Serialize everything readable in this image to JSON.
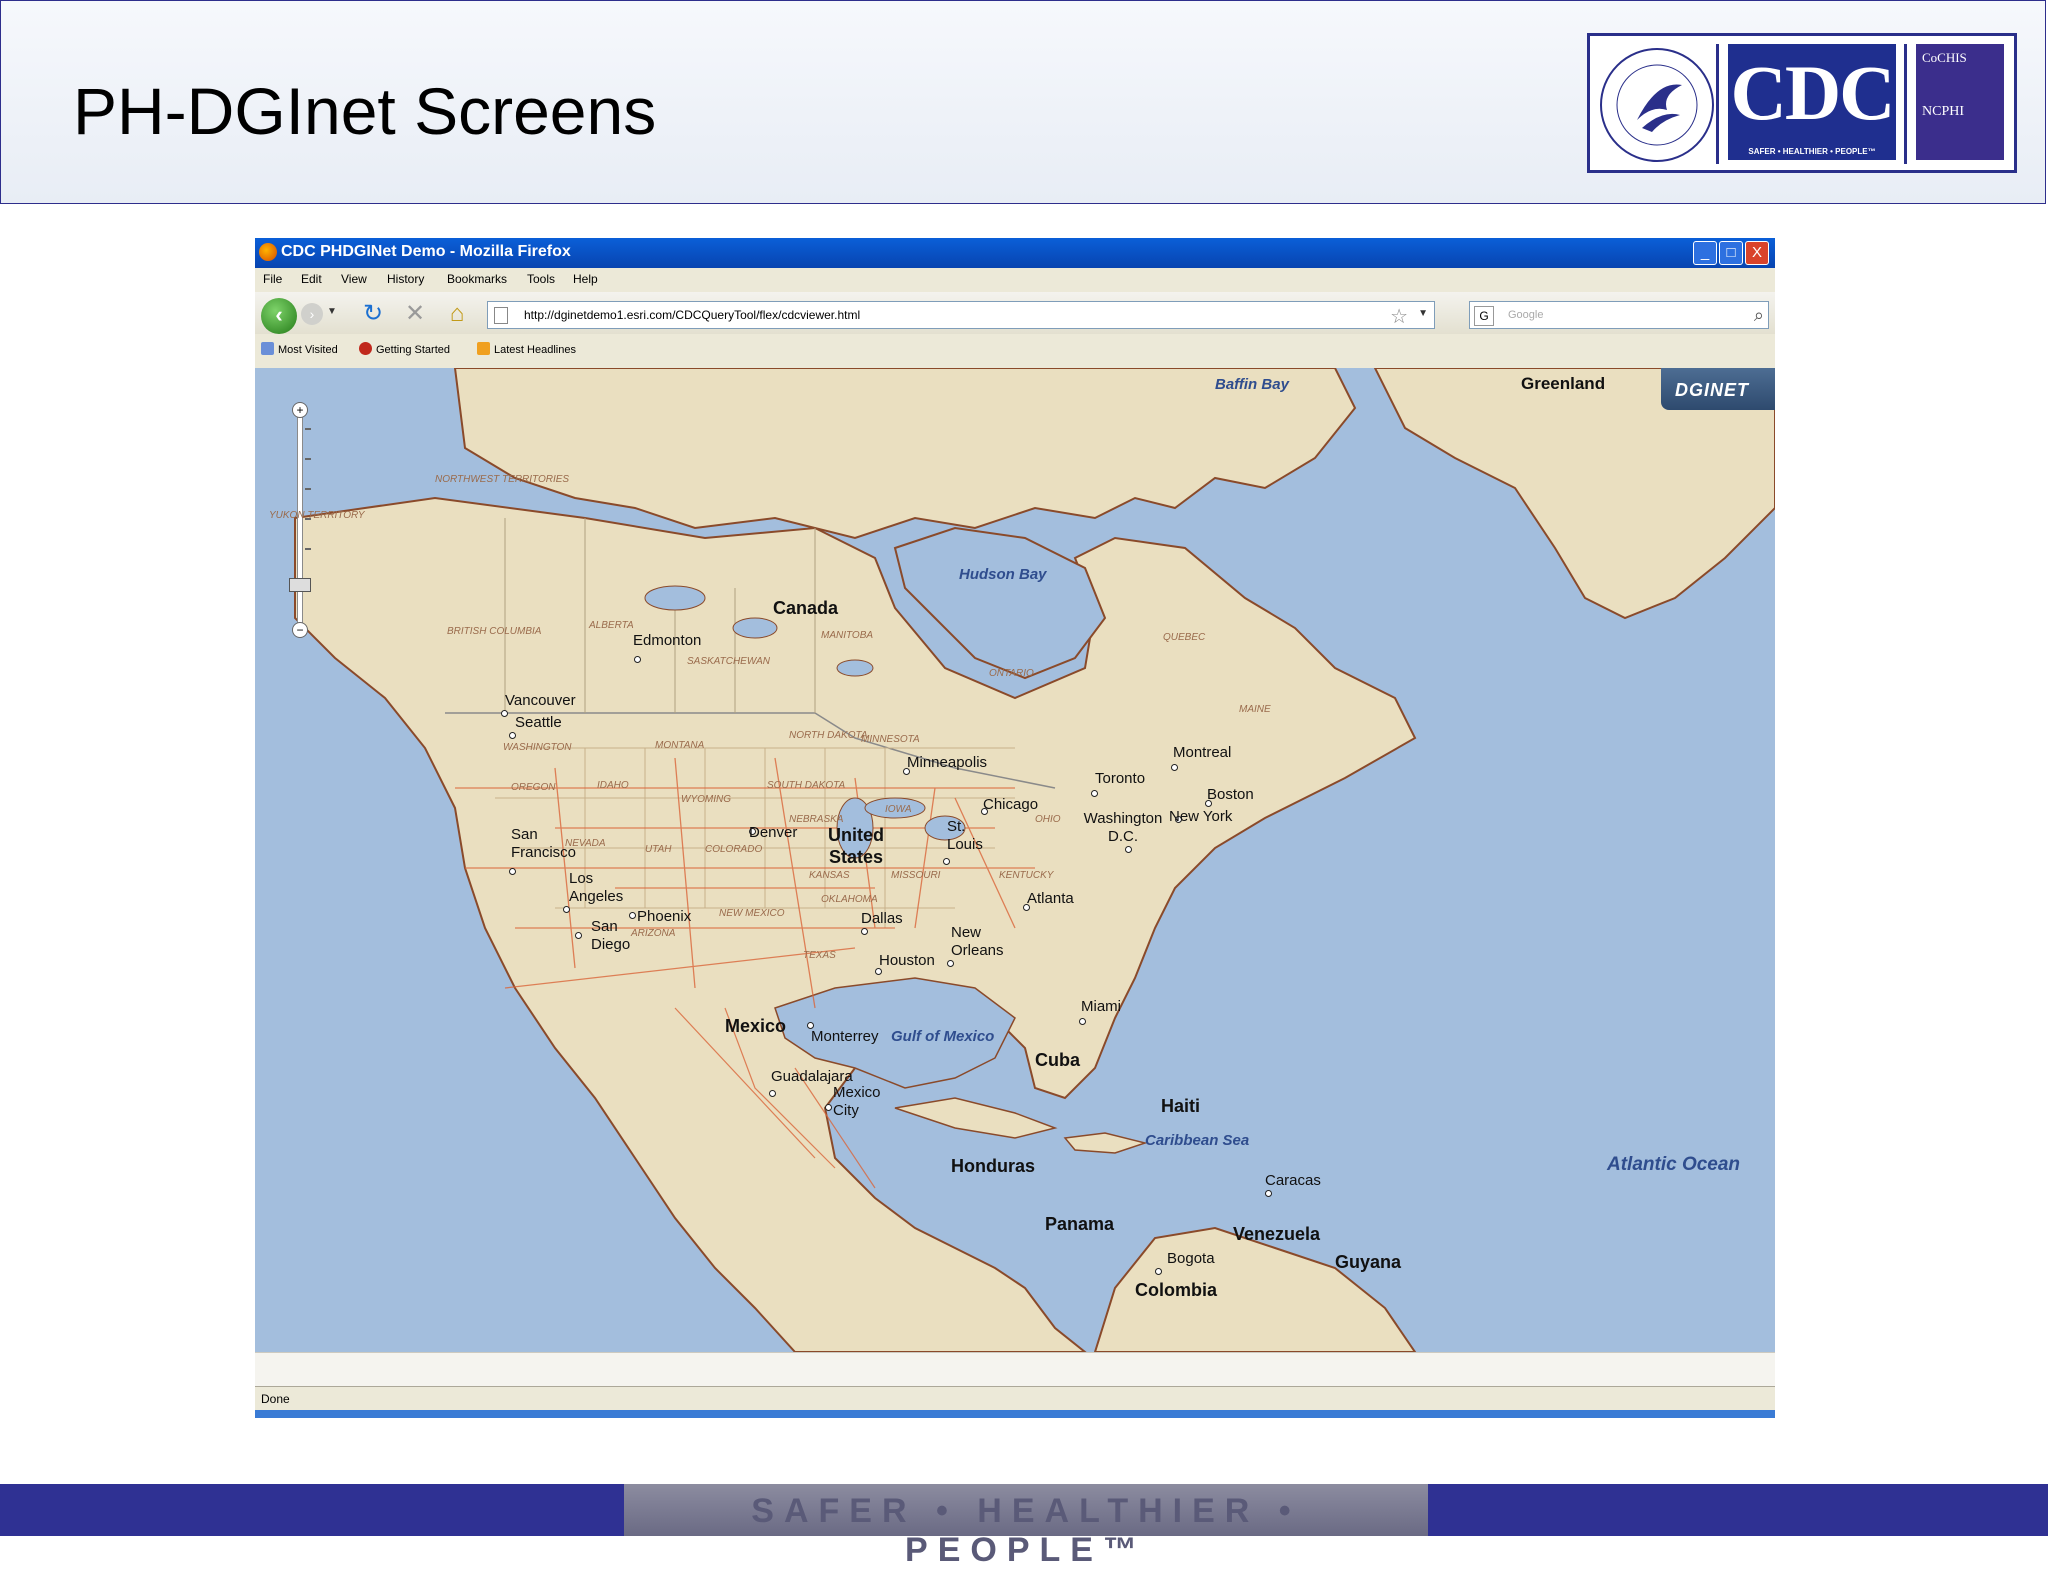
{
  "slide": {
    "title": "PH-DGInet Screens",
    "footer": "SAFER • HEALTHIER • PEOPLE™"
  },
  "logo": {
    "cdc": "CDC",
    "tagline": "SAFER • HEALTHIER • PEOPLE™",
    "cocheis": "CoCHIS",
    "ncphi": "NCPHI"
  },
  "window": {
    "title": "CDC PHDGINet Demo - Mozilla Firefox",
    "controls": {
      "minimize": "_",
      "maximize": "□",
      "close": "X"
    }
  },
  "menu": [
    "File",
    "Edit",
    "View",
    "History",
    "Bookmarks",
    "Tools",
    "Help"
  ],
  "navigation": {
    "url": "http://dginetdemo1.esri.com/CDCQueryTool/flex/cdcviewer.html",
    "search_placeholder": "Google"
  },
  "bookmarks": [
    "Most Visited",
    "Getting Started",
    "Latest Headlines"
  ],
  "map": {
    "brand": "DGINET",
    "countries": [
      "Canada",
      "United States",
      "Mexico",
      "Greenland",
      "Cuba",
      "Haiti",
      "Honduras",
      "Panama",
      "Venezuela",
      "Guyana",
      "Colombia"
    ],
    "water_bodies": [
      "Baffin Bay",
      "Hudson Bay",
      "Gulf of Mexico",
      "Caribbean Sea",
      "Atlantic Ocean"
    ],
    "regions": [
      "NORTHWEST TERRITORIES",
      "YUKON TERRITORY",
      "BRITISH COLUMBIA",
      "ALBERTA",
      "SASKATCHEWAN",
      "MANITOBA",
      "ONTARIO",
      "QUEBEC",
      "WASHINGTON",
      "OREGON",
      "IDAHO",
      "MONTANA",
      "WYOMING",
      "NEVADA",
      "UTAH",
      "COLORADO",
      "NORTH DAKOTA",
      "SOUTH DAKOTA",
      "NEBRASKA",
      "KANSAS",
      "MINNESOTA",
      "IOWA",
      "MISSOURI",
      "OKLAHOMA",
      "TEXAS",
      "NEW MEXICO",
      "ARIZONA",
      "OHIO",
      "KENTUCKY",
      "MAINE"
    ],
    "cities": [
      "Edmonton",
      "Vancouver",
      "Seattle",
      "San Francisco",
      "Los Angeles",
      "San Diego",
      "Phoenix",
      "Denver",
      "Minneapolis",
      "Chicago",
      "St. Louis",
      "Dallas",
      "Houston",
      "New Orleans",
      "Atlanta",
      "Miami",
      "Toronto",
      "Montreal",
      "Boston",
      "New York",
      "Washington D.C.",
      "Monterrey",
      "Guadalajara",
      "Mexico City",
      "Caracas",
      "Bogota"
    ]
  },
  "status": "Done",
  "colors": {
    "header_border": "#2e2e8c",
    "footer_bar": "#2f3193",
    "ocean": "#a3bedd",
    "land": "#eadfc0",
    "roads": "#d9653a"
  }
}
